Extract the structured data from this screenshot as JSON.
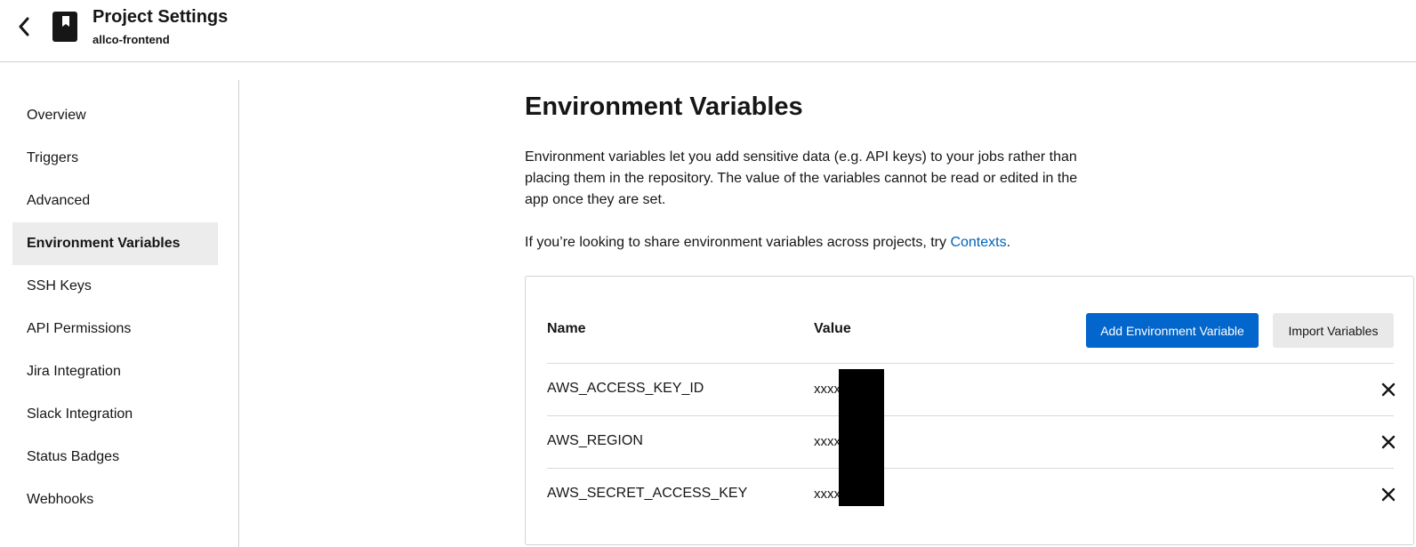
{
  "header": {
    "title": "Project Settings",
    "subtitle": "allco-frontend",
    "back_icon": "chevron-left-icon",
    "project_icon": "bookmark-book-icon"
  },
  "sidebar": {
    "items": [
      {
        "label": "Overview",
        "active": false
      },
      {
        "label": "Triggers",
        "active": false
      },
      {
        "label": "Advanced",
        "active": false
      },
      {
        "label": "Environment Variables",
        "active": true
      },
      {
        "label": "SSH Keys",
        "active": false
      },
      {
        "label": "API Permissions",
        "active": false
      },
      {
        "label": "Jira Integration",
        "active": false
      },
      {
        "label": "Slack Integration",
        "active": false
      },
      {
        "label": "Status Badges",
        "active": false
      },
      {
        "label": "Webhooks",
        "active": false
      }
    ]
  },
  "main": {
    "title": "Environment Variables",
    "description": "Environment variables let you add sensitive data (e.g. API keys) to your jobs rather than placing them in the repository. The value of the variables cannot be read or edited in the app once they are set.",
    "contexts_prefix": "If you’re looking to share environment variables across projects, try ",
    "contexts_link": "Contexts",
    "contexts_suffix": "."
  },
  "table": {
    "columns": {
      "name": "Name",
      "value": "Value"
    },
    "add_button": "Add Environment Variable",
    "import_button": "Import Variables",
    "rows": [
      {
        "name": "AWS_ACCESS_KEY_ID",
        "value": "xxxx"
      },
      {
        "name": "AWS_REGION",
        "value": "xxxx"
      },
      {
        "name": "AWS_SECRET_ACCESS_KEY",
        "value": "xxxx"
      }
    ],
    "delete_icon": "close-icon"
  },
  "colors": {
    "primary": "#0366cc",
    "link": "#0062b8",
    "active_bg": "#ececec",
    "redaction": "#000000"
  }
}
